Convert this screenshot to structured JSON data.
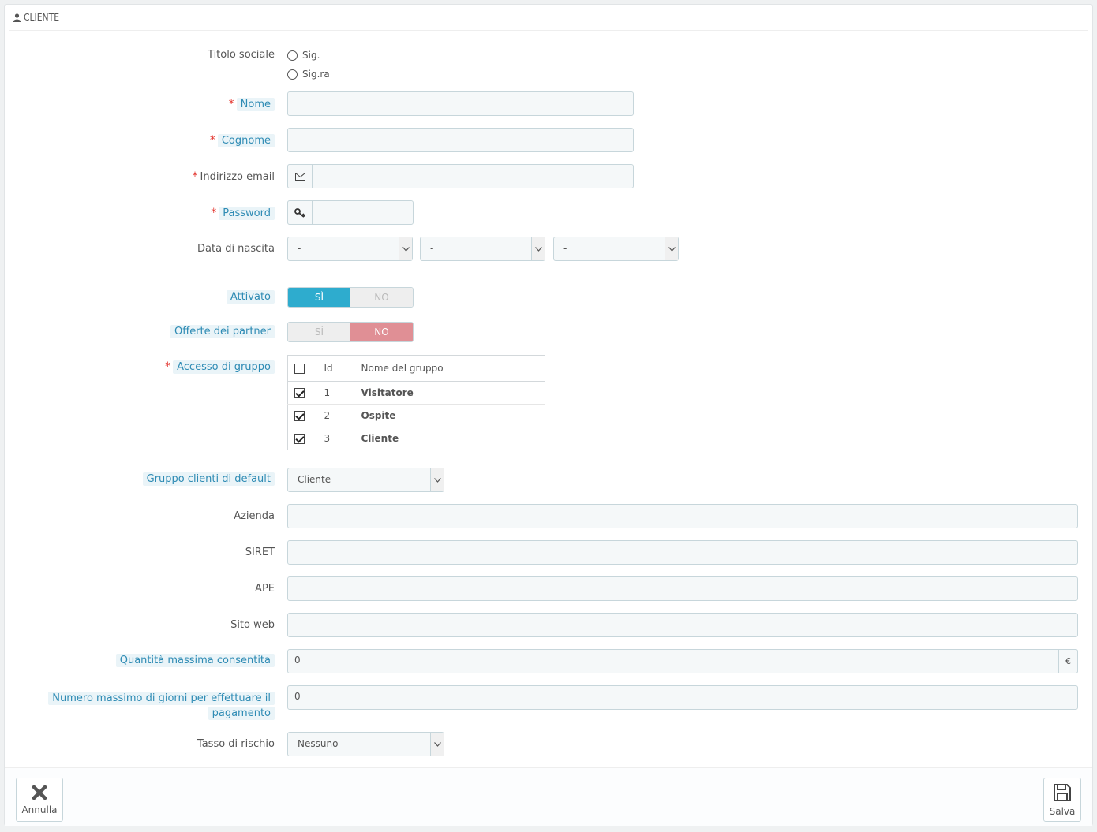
{
  "panel": {
    "title": "Cliente"
  },
  "form": {
    "title_label": "Titolo sociale",
    "title_options": [
      "Sig.",
      "Sig.ra"
    ],
    "first_name_label": "Nome",
    "last_name_label": "Cognome",
    "email_label": "Indirizzo email",
    "password_label": "Password",
    "birthday_label": "Data di nascita",
    "birthday_values": [
      "-",
      "-",
      "-"
    ],
    "active_label": "Attivato",
    "active_yes": "Sì",
    "active_no": "No",
    "active_value": "Sì",
    "optin_label": "Offerte dei partner",
    "optin_yes": "Sì",
    "optin_no": "No",
    "optin_value": "No",
    "group_access_label": "Accesso di gruppo",
    "groups_header": {
      "id": "Id",
      "name": "Nome del gruppo"
    },
    "groups": [
      {
        "id": "1",
        "name": "Visitatore",
        "checked": true
      },
      {
        "id": "2",
        "name": "Ospite",
        "checked": true
      },
      {
        "id": "3",
        "name": "Cliente",
        "checked": true
      }
    ],
    "default_group_label": "Gruppo clienti di default",
    "default_group_value": "Cliente",
    "company_label": "Azienda",
    "siret_label": "SIRET",
    "ape_label": "APE",
    "website_label": "Sito web",
    "max_amount_label": "Quantità massima consentita",
    "max_amount_value": "0",
    "currency_symbol": "€",
    "max_days_label_line1": "Numero massimo di giorni per effettuare il",
    "max_days_label_line2": "pagamento",
    "max_days_value": "0",
    "risk_label": "Tasso di rischio",
    "risk_value": "Nessuno"
  },
  "footer": {
    "cancel_label": "Annulla",
    "save_label": "Salva"
  },
  "colors": {
    "switch_on": "#2eacce",
    "switch_no": "#e08f95",
    "required": "#e3352e",
    "hint_text": "#2e8bb4"
  }
}
